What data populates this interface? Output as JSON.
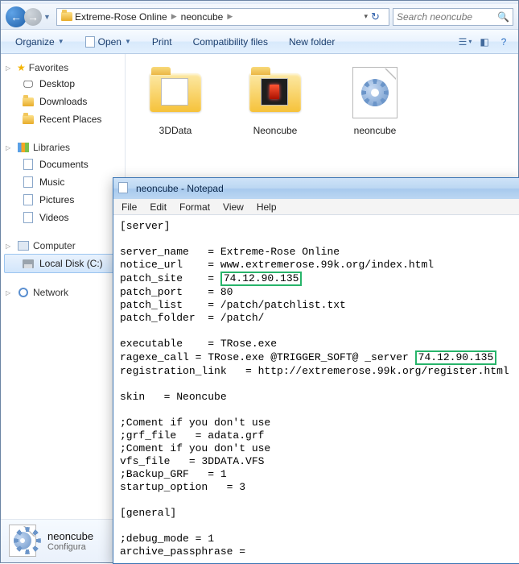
{
  "explorer": {
    "breadcrumb": [
      "Extreme-Rose Online",
      "neoncube"
    ],
    "search_placeholder": "Search neoncube",
    "toolbar": {
      "organize": "Organize",
      "open": "Open",
      "print": "Print",
      "compat": "Compatibility files",
      "newfolder": "New folder"
    },
    "sidebar": {
      "favorites": {
        "label": "Favorites",
        "items": [
          "Desktop",
          "Downloads",
          "Recent Places"
        ]
      },
      "libraries": {
        "label": "Libraries",
        "items": [
          "Documents",
          "Music",
          "Pictures",
          "Videos"
        ]
      },
      "computer": {
        "label": "Computer",
        "items": [
          "Local Disk (C:)"
        ]
      },
      "network": {
        "label": "Network"
      }
    },
    "items": [
      {
        "name": "3DData",
        "kind": "folder"
      },
      {
        "name": "Neoncube",
        "kind": "folder-neon"
      },
      {
        "name": "neoncube",
        "kind": "file-config"
      }
    ],
    "details": {
      "name": "neoncube",
      "type": "Configura"
    }
  },
  "notepad": {
    "title": "neoncube - Notepad",
    "menu": [
      "File",
      "Edit",
      "Format",
      "View",
      "Help"
    ],
    "config": {
      "section1": "[server]",
      "server_name_k": "server_name",
      "server_name_v": "Extreme-Rose Online",
      "notice_url_k": "notice_url",
      "notice_url_v": "www.extremerose.99k.org/index.html",
      "patch_site_k": "patch_site",
      "patch_site_v": "74.12.90.135",
      "patch_port_k": "patch_port",
      "patch_port_v": "80",
      "patch_list_k": "patch_list",
      "patch_list_v": "/patch/patchlist.txt",
      "patch_folder_k": "patch_folder",
      "patch_folder_v": "/patch/",
      "executable_k": "executable",
      "executable_v": "TRose.exe",
      "ragexe_prefix": "ragexe_call = TRose.exe @TRIGGER_SOFT@ _server ",
      "ragexe_ip": "74.12.90.135",
      "reg_link": "registration_link   = http://extremerose.99k.org/register.html",
      "skin": "skin   = Neoncube",
      "c1": ";Coment if you don't use",
      "grf": ";grf_file   = adata.grf",
      "c2": ";Coment if you don't use",
      "vfs": "vfs_file   = 3DDATA.VFS",
      "bkg": ";Backup_GRF   = 1",
      "startup": "startup_option   = 3",
      "section2": "[general]",
      "dbg": ";debug_mode = 1",
      "arch": "archive_passphrase ="
    }
  }
}
